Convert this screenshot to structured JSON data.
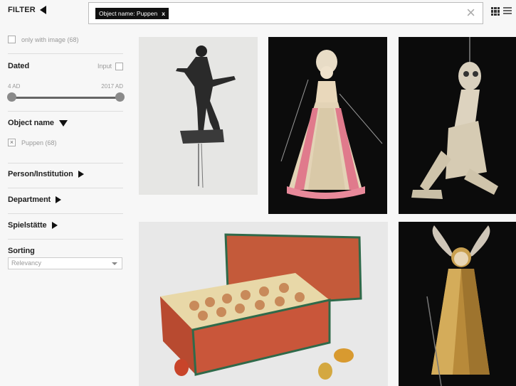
{
  "filter": {
    "label": "FILTER"
  },
  "only_image": {
    "label": "only with image (68)"
  },
  "dated": {
    "title": "Dated",
    "input_label": "Input",
    "min_label": "4 AD",
    "max_label": "2017 AD"
  },
  "object_name": {
    "title": "Object name",
    "option_label": "Puppen (68)"
  },
  "sections": {
    "person": "Person/Institution",
    "department": "Department",
    "spielstaette": "Spielstätte"
  },
  "sorting": {
    "title": "Sorting",
    "value": "Relevancy"
  },
  "search": {
    "chip_label": "Object name: Puppen",
    "chip_remove": "x",
    "clear": "×"
  },
  "colors": {
    "background": "#f7f7f7",
    "chip": "#111111",
    "accent_pink": "#e07a8c"
  },
  "tiles": [
    {
      "name": "shadow-puppet",
      "icon": "shadow-puppet-photo"
    },
    {
      "name": "doll-in-pink-gown",
      "icon": "doll-photo"
    },
    {
      "name": "marionette-figure",
      "icon": "marionette-photo"
    },
    {
      "name": "box-of-puppet-heads",
      "icon": "box-photo"
    },
    {
      "name": "golden-angel",
      "icon": "angel-photo"
    }
  ]
}
